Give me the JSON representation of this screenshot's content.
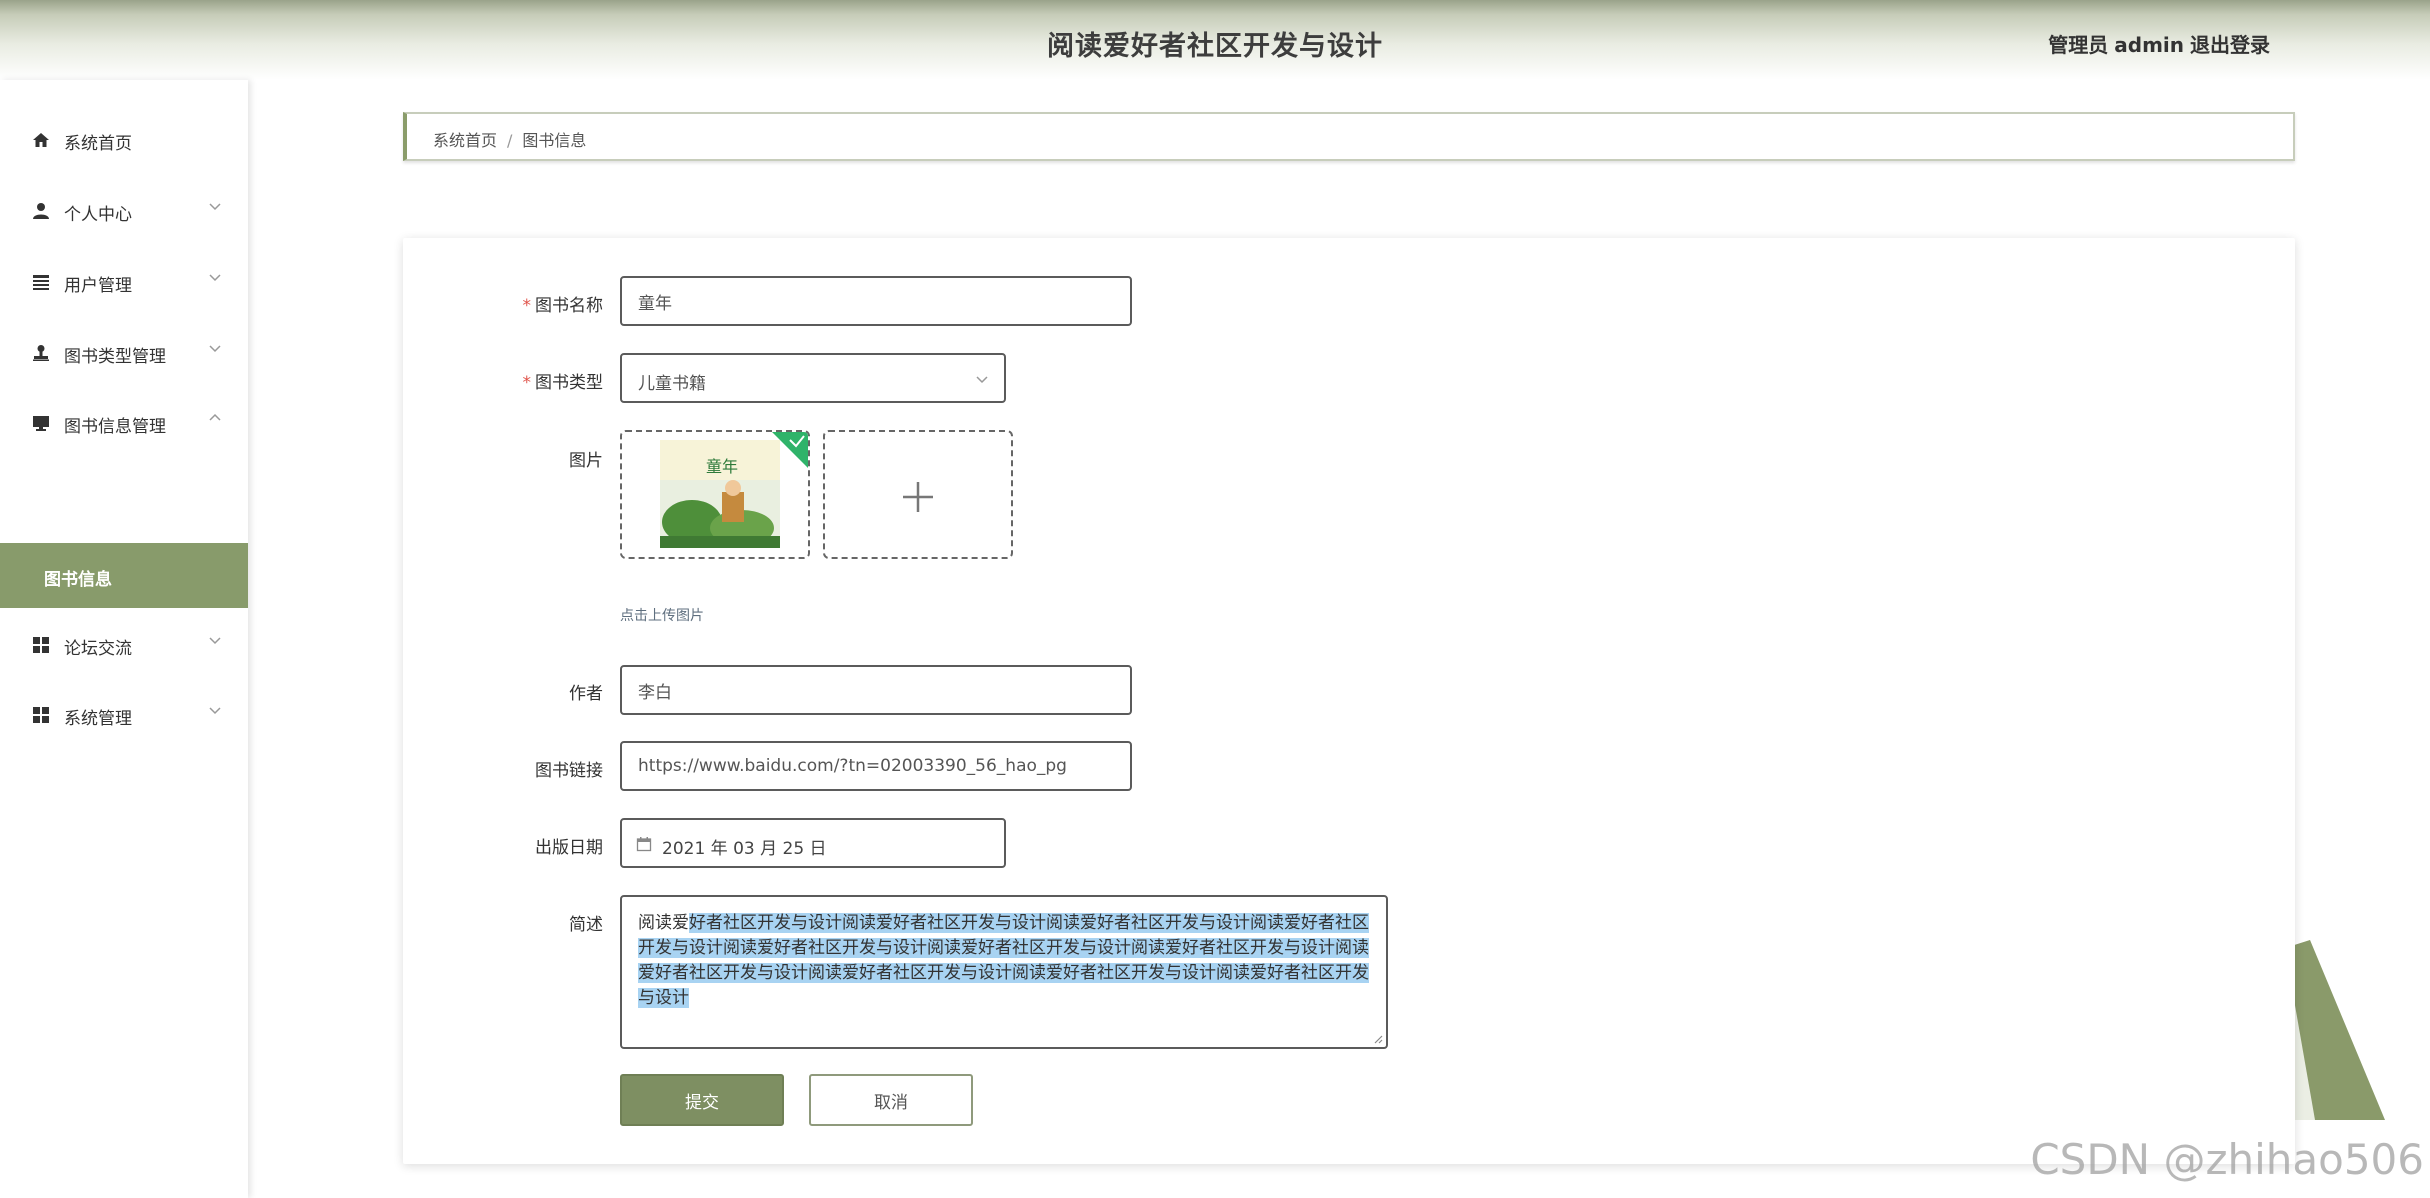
{
  "header": {
    "title": "阅读爱好者社区开发与设计",
    "role": "管理员",
    "username": "admin",
    "logout_label": "退出登录"
  },
  "sidebar": {
    "items": [
      {
        "label": "系统首页",
        "icon": "home-icon"
      },
      {
        "label": "个人中心",
        "icon": "user-icon"
      },
      {
        "label": "用户管理",
        "icon": "list-icon"
      },
      {
        "label": "图书类型管理",
        "icon": "stamp-icon"
      },
      {
        "label": "图书信息管理",
        "icon": "monitor-icon"
      },
      {
        "label": "论坛交流",
        "icon": "grid-icon"
      },
      {
        "label": "系统管理",
        "icon": "grid-icon"
      }
    ],
    "active_sub_item": "图书信息"
  },
  "breadcrumb": {
    "home": "系统首页",
    "separator": "/",
    "current": "图书信息"
  },
  "form": {
    "name": {
      "label": "图书名称",
      "value": "童年",
      "required": true
    },
    "type": {
      "label": "图书类型",
      "value": "儿童书籍",
      "required": true
    },
    "image": {
      "label": "图片",
      "thumbnail_title": "童年",
      "hint": "点击上传图片"
    },
    "author": {
      "label": "作者",
      "value": "李白"
    },
    "link": {
      "label": "图书链接",
      "value": "https://www.baidu.com/?tn=02003390_56_hao_pg"
    },
    "date": {
      "label": "出版日期",
      "value": "2021 年 03 月 25 日"
    },
    "description": {
      "label": "简述",
      "value_unselected": "阅读爱",
      "value_selected": "好者社区开发与设计阅读爱好者社区开发与设计阅读爱好者社区开发与设计阅读爱好者社区开发与设计阅读爱好者社区开发与设计阅读爱好者社区开发与设计阅读爱好者社区开发与设计阅读爱好者社区开发与设计阅读爱好者社区开发与设计阅读爱好者社区开发与设计阅读爱好者社区开发与设计"
    },
    "submit_label": "提交",
    "cancel_label": "取消"
  },
  "watermark": "CSDN @zhihao506",
  "colors": {
    "accent": "#889b6b",
    "button": "#7e8f62",
    "required": "#e0534a",
    "selection": "#a8d3f2"
  }
}
